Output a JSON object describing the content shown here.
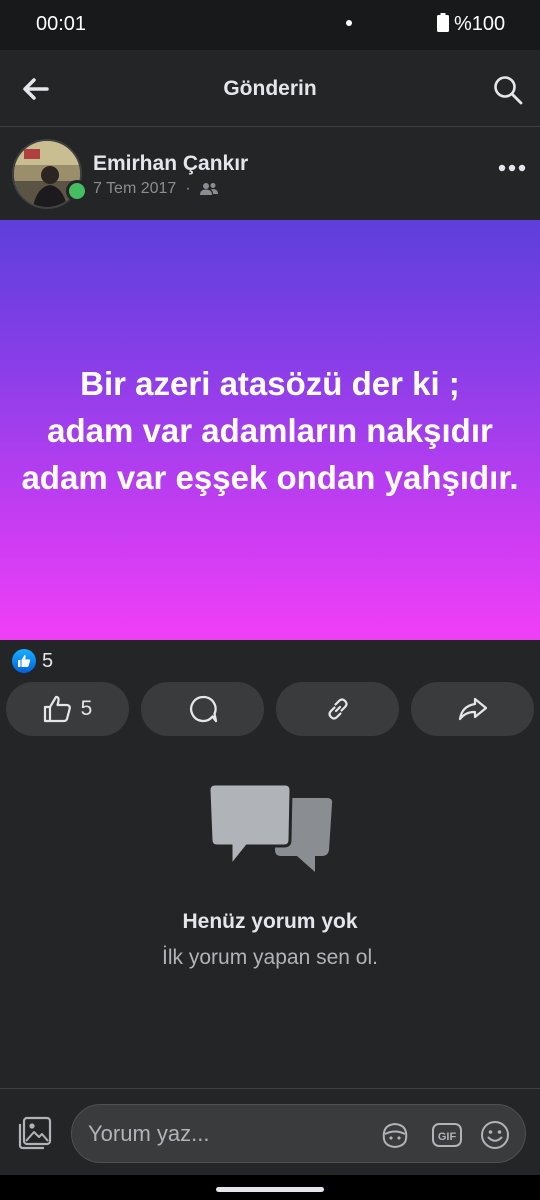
{
  "status_bar": {
    "time": "00:01",
    "battery": "%100"
  },
  "header": {
    "title": "Gönderin"
  },
  "post": {
    "author": "Emirhan Çankır",
    "date": "7 Tem 2017",
    "separator": "·",
    "text_lines": [
      "Bir azeri atasözü der ki ;",
      "adam var adamların nakşıdır",
      "adam var eşşek ondan yahşıdır."
    ],
    "reaction_count": "5",
    "like_count": "5"
  },
  "comments": {
    "empty_title": "Henüz yorum yok",
    "empty_subtitle": "İlk yorum yapan sen ol."
  },
  "composer": {
    "placeholder": "Yorum yaz..."
  },
  "colors": {
    "background": "#242526",
    "accent_like": "#1877f2",
    "online": "#45bd62",
    "gradient_top": "#5d3fdc",
    "gradient_bottom": "#f13ef7"
  }
}
